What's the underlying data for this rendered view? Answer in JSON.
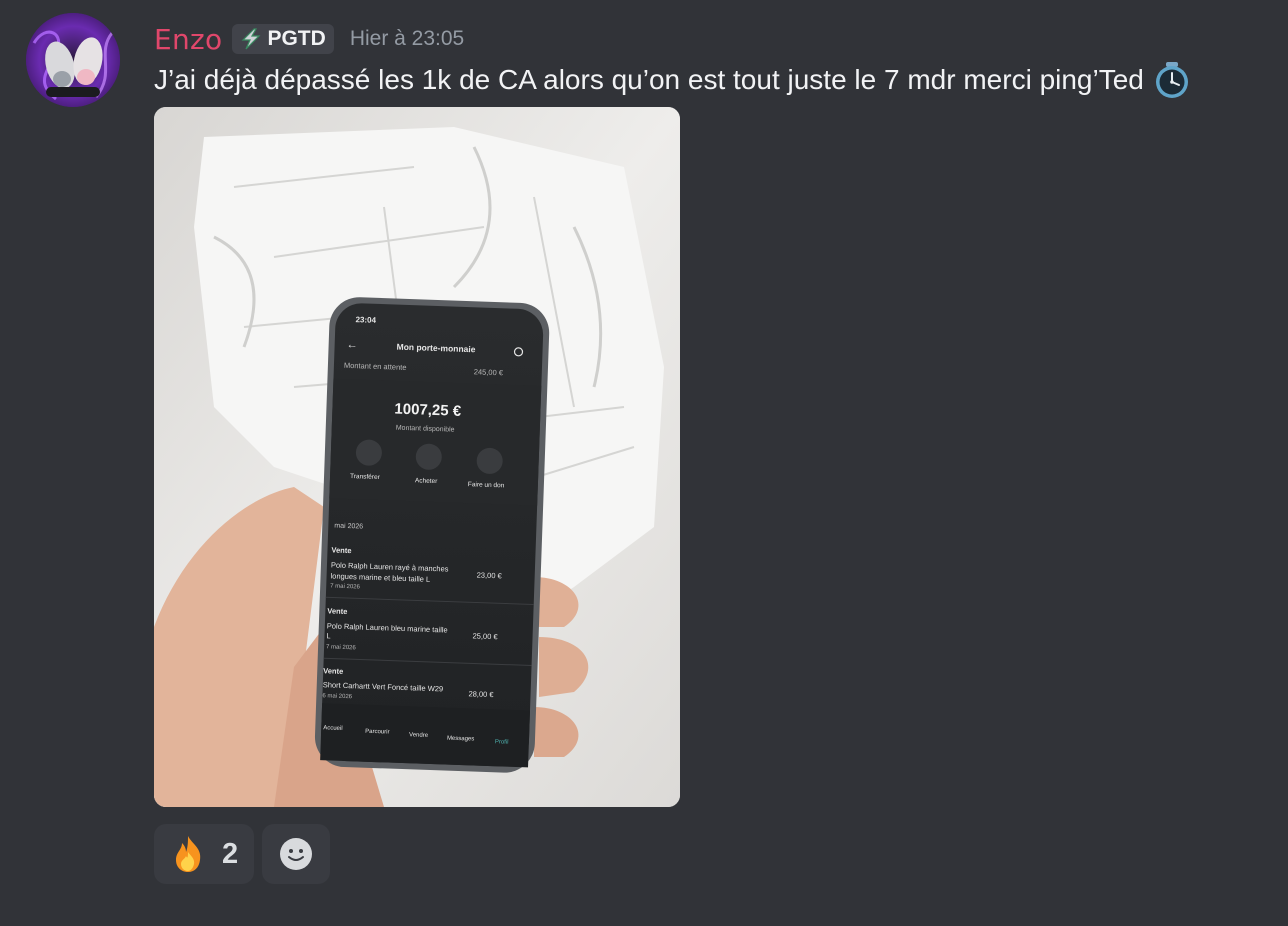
{
  "message": {
    "author": "Enzo",
    "guild_tag": "PGTD",
    "timestamp": "Hier à 23:05",
    "text": "J’ai déjà dépassé les 1k de CA alors qu’on est tout juste le 7 mdr merci ping’Ted",
    "author_color": "#e0476b"
  },
  "phone": {
    "time": "23:04",
    "title": "Mon porte-monnaie",
    "pending_label": "Montant en attente",
    "pending_amount": "245,00 €",
    "balance": "1007,25 €",
    "balance_label": "Montant disponible",
    "actions": [
      "Transférer",
      "Acheter",
      "Faire un don"
    ],
    "month": "mai 2026",
    "transactions": [
      {
        "type": "Vente",
        "title_line1": "Polo Ralph Lauren rayé à manches",
        "title_line2": "longues marine et bleu taille L",
        "date": "7 mai 2026",
        "amount": "23,00 €"
      },
      {
        "type": "Vente",
        "title_line1": "Polo Ralph Lauren bleu marine taille",
        "title_line2": "L",
        "date": "7 mai 2026",
        "amount": "25,00 €"
      },
      {
        "type": "Vente",
        "title_line1": "Short Carhartt Vert Foncé taille W29",
        "title_line2": "",
        "date": "6 mai 2026",
        "amount": "28,00 €"
      }
    ],
    "nav": [
      "Accueil",
      "Parcourir",
      "Vendre",
      "Messages",
      "Profil"
    ]
  },
  "reactions": [
    {
      "emoji": "fire-emoji",
      "count": "2"
    }
  ],
  "add_reaction_icon": "smiley-icon"
}
